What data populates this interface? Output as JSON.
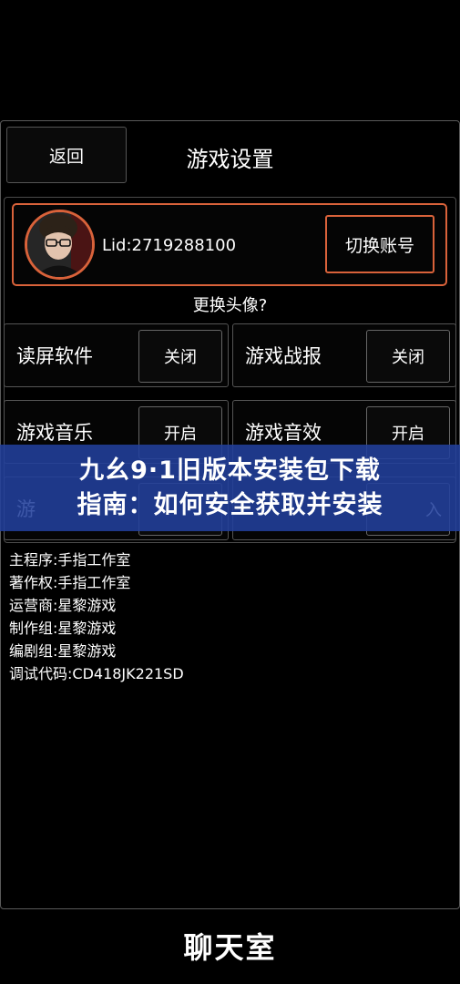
{
  "header": {
    "back_label": "返回",
    "title": "游戏设置"
  },
  "account": {
    "lid": "Lid:2719288100",
    "switch_label": "切换账号",
    "change_avatar": "更换头像?"
  },
  "settings": [
    {
      "label": "读屏软件",
      "value": "关闭"
    },
    {
      "label": "游戏战报",
      "value": "关闭"
    },
    {
      "label": "游戏音乐",
      "value": "开启"
    },
    {
      "label": "游戏音效",
      "value": "开启"
    },
    {
      "label": "游",
      "value": ""
    },
    {
      "label": "",
      "value": "入"
    }
  ],
  "banner": {
    "line1": "九幺9·1旧版本安装包下载",
    "line2": "指南：如何安全获取并安装"
  },
  "credits": [
    "主程序:手指工作室",
    "著作权:手指工作室",
    "运营商:星黎游戏",
    "制作组:星黎游戏",
    "编剧组:星黎游戏",
    "调试代码:CD418JK221SD"
  ],
  "footer": {
    "chat_title": "聊天室"
  },
  "colors": {
    "accent": "#d9623a",
    "banner": "#22409c",
    "background": "#000000"
  }
}
